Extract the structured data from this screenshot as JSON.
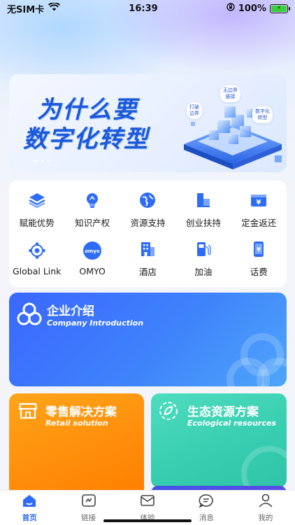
{
  "status_bar": {
    "carrier": "无SIM卡",
    "time": "16:39",
    "battery": "100%"
  },
  "banner": {
    "title_line1": "为什么要",
    "title_line2": "数字化转型",
    "bubble_1": "无边界\n链接",
    "bubble_2": "打破\n边界",
    "bubble_3": "数字化\n转型"
  },
  "menu": {
    "items": [
      {
        "label": "赋能优势",
        "icon": "layers-icon"
      },
      {
        "label": "知识产权",
        "icon": "lightbulb-icon"
      },
      {
        "label": "资源支持",
        "icon": "globe-icon"
      },
      {
        "label": "创业扶持",
        "icon": "building-blocks-icon"
      },
      {
        "label": "定金返还",
        "icon": "ticket-icon"
      },
      {
        "label": "Global Link",
        "icon": "network-icon"
      },
      {
        "label": "OMYO",
        "icon": "omyo-logo-icon"
      },
      {
        "label": "酒店",
        "icon": "hotel-icon"
      },
      {
        "label": "加油",
        "icon": "fuel-pump-icon"
      },
      {
        "label": "话费",
        "icon": "phone-bill-icon"
      }
    ]
  },
  "cards": {
    "company": {
      "title": "企业介绍",
      "subtitle": "Company Introduction"
    },
    "retail": {
      "title": "零售解决方案",
      "subtitle": "Retail solution"
    },
    "eco": {
      "title": "生态资源方案",
      "subtitle": "Ecological resources"
    }
  },
  "tabs": [
    {
      "label": "首页",
      "icon": "home-icon",
      "active": true
    },
    {
      "label": "链接",
      "icon": "link-icon",
      "active": false
    },
    {
      "label": "体验",
      "icon": "mail-icon",
      "active": false
    },
    {
      "label": "消息",
      "icon": "message-icon",
      "active": false
    },
    {
      "label": "我的",
      "icon": "profile-icon",
      "active": false
    }
  ],
  "colors": {
    "accent": "#2f6cf5",
    "company_card": "#3f83fb",
    "retail_card": "#ff8c0a",
    "eco_card": "#37cdb0"
  }
}
